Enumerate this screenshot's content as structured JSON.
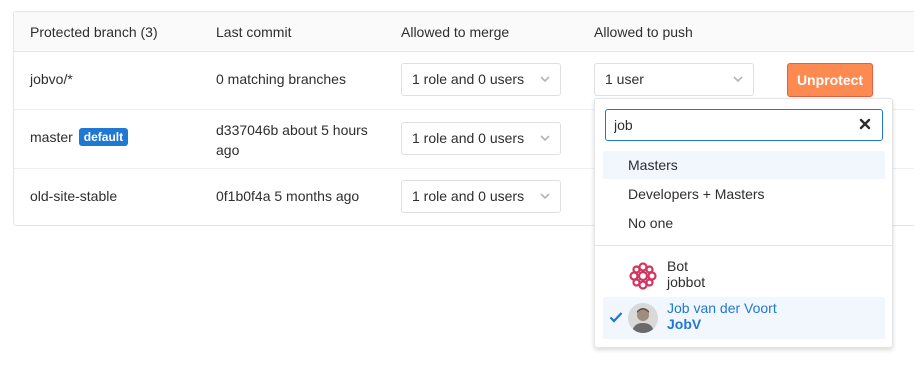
{
  "table": {
    "headers": [
      "Protected branch (3)",
      "Last commit",
      "Allowed to merge",
      "Allowed to push"
    ],
    "rows": [
      {
        "branch": "jobvo/*",
        "badge": "",
        "commit": "0 matching branches",
        "merge": "1 role and 0 users",
        "push": "1 user",
        "action": "Unprotect"
      },
      {
        "branch": "master",
        "badge": "default",
        "commit_line1": "d337046b about 5 hours",
        "commit_line2": "ago",
        "merge": "1 role and 0 users"
      },
      {
        "branch": "old-site-stable",
        "badge": "",
        "commit": "0f1b0f4a 5 months ago",
        "merge": "1 role and 0 users"
      }
    ]
  },
  "dropdown": {
    "search_value": "job",
    "roles": [
      "Masters",
      "Developers + Masters",
      "No one"
    ],
    "users": [
      {
        "name": "Bot",
        "username": "jobbot",
        "selected": false
      },
      {
        "name": "Job van der Voort",
        "username": "JobV",
        "selected": true
      }
    ]
  },
  "colors": {
    "primary": "#1f78d1",
    "unprotect": "#fc8a51",
    "highlight": "#f2f7fd"
  },
  "icons": {
    "caret": "chevron-down-icon",
    "clear": "close-icon",
    "check": "check-icon"
  }
}
